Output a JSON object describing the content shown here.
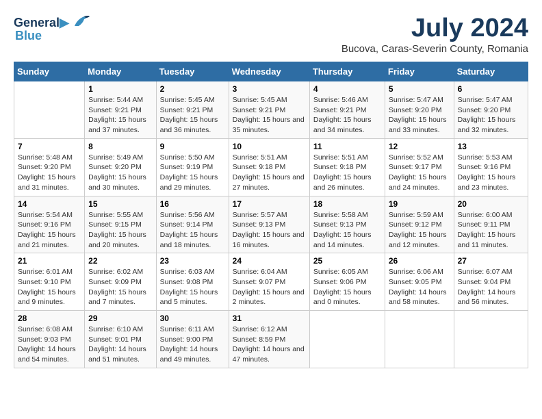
{
  "header": {
    "logo_line1": "General",
    "logo_line2": "Blue",
    "month_title": "July 2024",
    "location": "Bucova, Caras-Severin County, Romania"
  },
  "weekdays": [
    "Sunday",
    "Monday",
    "Tuesday",
    "Wednesday",
    "Thursday",
    "Friday",
    "Saturday"
  ],
  "weeks": [
    [
      {
        "day": "",
        "sunrise": "",
        "sunset": "",
        "daylight": ""
      },
      {
        "day": "1",
        "sunrise": "Sunrise: 5:44 AM",
        "sunset": "Sunset: 9:21 PM",
        "daylight": "Daylight: 15 hours and 37 minutes."
      },
      {
        "day": "2",
        "sunrise": "Sunrise: 5:45 AM",
        "sunset": "Sunset: 9:21 PM",
        "daylight": "Daylight: 15 hours and 36 minutes."
      },
      {
        "day": "3",
        "sunrise": "Sunrise: 5:45 AM",
        "sunset": "Sunset: 9:21 PM",
        "daylight": "Daylight: 15 hours and 35 minutes."
      },
      {
        "day": "4",
        "sunrise": "Sunrise: 5:46 AM",
        "sunset": "Sunset: 9:21 PM",
        "daylight": "Daylight: 15 hours and 34 minutes."
      },
      {
        "day": "5",
        "sunrise": "Sunrise: 5:47 AM",
        "sunset": "Sunset: 9:20 PM",
        "daylight": "Daylight: 15 hours and 33 minutes."
      },
      {
        "day": "6",
        "sunrise": "Sunrise: 5:47 AM",
        "sunset": "Sunset: 9:20 PM",
        "daylight": "Daylight: 15 hours and 32 minutes."
      }
    ],
    [
      {
        "day": "7",
        "sunrise": "Sunrise: 5:48 AM",
        "sunset": "Sunset: 9:20 PM",
        "daylight": "Daylight: 15 hours and 31 minutes."
      },
      {
        "day": "8",
        "sunrise": "Sunrise: 5:49 AM",
        "sunset": "Sunset: 9:20 PM",
        "daylight": "Daylight: 15 hours and 30 minutes."
      },
      {
        "day": "9",
        "sunrise": "Sunrise: 5:50 AM",
        "sunset": "Sunset: 9:19 PM",
        "daylight": "Daylight: 15 hours and 29 minutes."
      },
      {
        "day": "10",
        "sunrise": "Sunrise: 5:51 AM",
        "sunset": "Sunset: 9:18 PM",
        "daylight": "Daylight: 15 hours and 27 minutes."
      },
      {
        "day": "11",
        "sunrise": "Sunrise: 5:51 AM",
        "sunset": "Sunset: 9:18 PM",
        "daylight": "Daylight: 15 hours and 26 minutes."
      },
      {
        "day": "12",
        "sunrise": "Sunrise: 5:52 AM",
        "sunset": "Sunset: 9:17 PM",
        "daylight": "Daylight: 15 hours and 24 minutes."
      },
      {
        "day": "13",
        "sunrise": "Sunrise: 5:53 AM",
        "sunset": "Sunset: 9:16 PM",
        "daylight": "Daylight: 15 hours and 23 minutes."
      }
    ],
    [
      {
        "day": "14",
        "sunrise": "Sunrise: 5:54 AM",
        "sunset": "Sunset: 9:16 PM",
        "daylight": "Daylight: 15 hours and 21 minutes."
      },
      {
        "day": "15",
        "sunrise": "Sunrise: 5:55 AM",
        "sunset": "Sunset: 9:15 PM",
        "daylight": "Daylight: 15 hours and 20 minutes."
      },
      {
        "day": "16",
        "sunrise": "Sunrise: 5:56 AM",
        "sunset": "Sunset: 9:14 PM",
        "daylight": "Daylight: 15 hours and 18 minutes."
      },
      {
        "day": "17",
        "sunrise": "Sunrise: 5:57 AM",
        "sunset": "Sunset: 9:13 PM",
        "daylight": "Daylight: 15 hours and 16 minutes."
      },
      {
        "day": "18",
        "sunrise": "Sunrise: 5:58 AM",
        "sunset": "Sunset: 9:13 PM",
        "daylight": "Daylight: 15 hours and 14 minutes."
      },
      {
        "day": "19",
        "sunrise": "Sunrise: 5:59 AM",
        "sunset": "Sunset: 9:12 PM",
        "daylight": "Daylight: 15 hours and 12 minutes."
      },
      {
        "day": "20",
        "sunrise": "Sunrise: 6:00 AM",
        "sunset": "Sunset: 9:11 PM",
        "daylight": "Daylight: 15 hours and 11 minutes."
      }
    ],
    [
      {
        "day": "21",
        "sunrise": "Sunrise: 6:01 AM",
        "sunset": "Sunset: 9:10 PM",
        "daylight": "Daylight: 15 hours and 9 minutes."
      },
      {
        "day": "22",
        "sunrise": "Sunrise: 6:02 AM",
        "sunset": "Sunset: 9:09 PM",
        "daylight": "Daylight: 15 hours and 7 minutes."
      },
      {
        "day": "23",
        "sunrise": "Sunrise: 6:03 AM",
        "sunset": "Sunset: 9:08 PM",
        "daylight": "Daylight: 15 hours and 5 minutes."
      },
      {
        "day": "24",
        "sunrise": "Sunrise: 6:04 AM",
        "sunset": "Sunset: 9:07 PM",
        "daylight": "Daylight: 15 hours and 2 minutes."
      },
      {
        "day": "25",
        "sunrise": "Sunrise: 6:05 AM",
        "sunset": "Sunset: 9:06 PM",
        "daylight": "Daylight: 15 hours and 0 minutes."
      },
      {
        "day": "26",
        "sunrise": "Sunrise: 6:06 AM",
        "sunset": "Sunset: 9:05 PM",
        "daylight": "Daylight: 14 hours and 58 minutes."
      },
      {
        "day": "27",
        "sunrise": "Sunrise: 6:07 AM",
        "sunset": "Sunset: 9:04 PM",
        "daylight": "Daylight: 14 hours and 56 minutes."
      }
    ],
    [
      {
        "day": "28",
        "sunrise": "Sunrise: 6:08 AM",
        "sunset": "Sunset: 9:03 PM",
        "daylight": "Daylight: 14 hours and 54 minutes."
      },
      {
        "day": "29",
        "sunrise": "Sunrise: 6:10 AM",
        "sunset": "Sunset: 9:01 PM",
        "daylight": "Daylight: 14 hours and 51 minutes."
      },
      {
        "day": "30",
        "sunrise": "Sunrise: 6:11 AM",
        "sunset": "Sunset: 9:00 PM",
        "daylight": "Daylight: 14 hours and 49 minutes."
      },
      {
        "day": "31",
        "sunrise": "Sunrise: 6:12 AM",
        "sunset": "Sunset: 8:59 PM",
        "daylight": "Daylight: 14 hours and 47 minutes."
      },
      {
        "day": "",
        "sunrise": "",
        "sunset": "",
        "daylight": ""
      },
      {
        "day": "",
        "sunrise": "",
        "sunset": "",
        "daylight": ""
      },
      {
        "day": "",
        "sunrise": "",
        "sunset": "",
        "daylight": ""
      }
    ]
  ]
}
